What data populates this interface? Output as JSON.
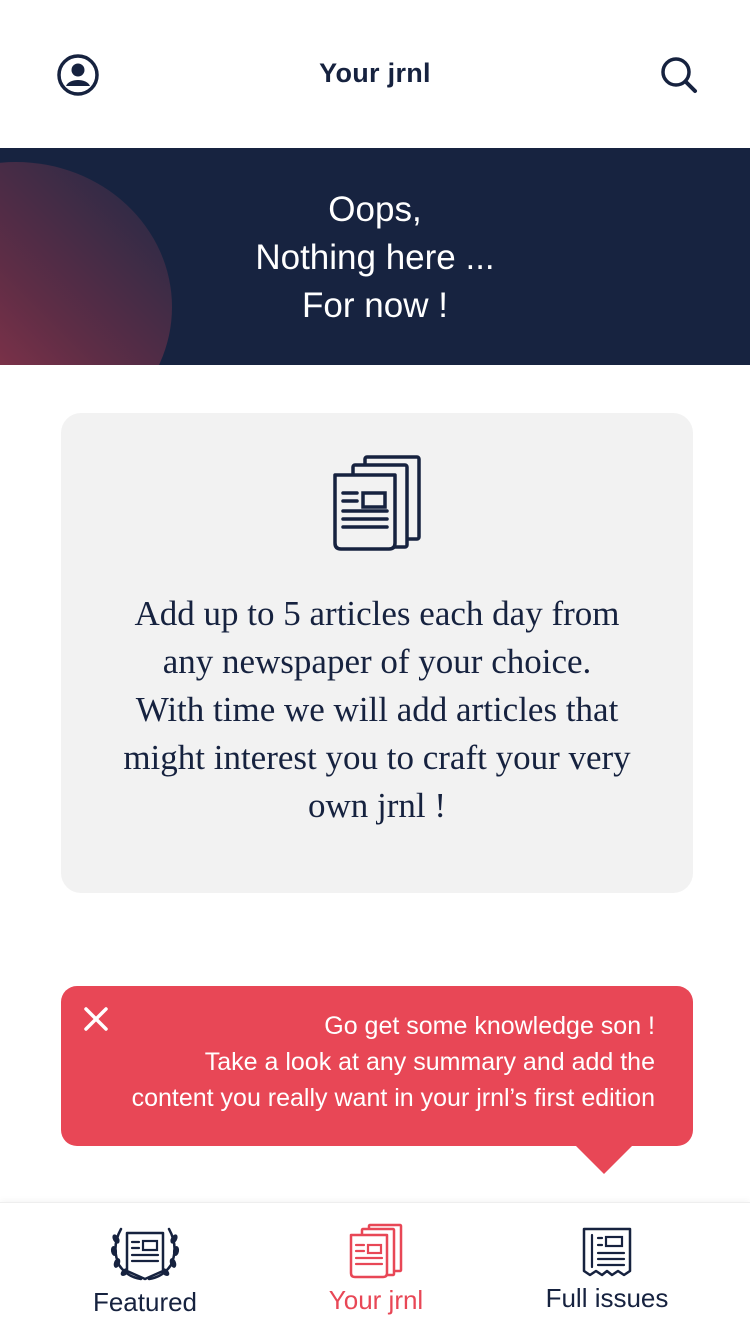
{
  "header": {
    "title": "Your jrnl",
    "left_icon": "profile-icon",
    "right_icon": "search-icon"
  },
  "banner": {
    "lines": [
      "Oops,",
      "Nothing here ...",
      "For now !"
    ]
  },
  "info": {
    "icon": "newspaper-stack-icon",
    "lines": [
      "Add up to 5 articles each day from",
      "any newspaper of your choice.",
      "With time we will add articles that",
      "might interest you to craft your very",
      "own jrnl !"
    ]
  },
  "toast": {
    "close_icon": "close-icon",
    "lines": [
      "Go get some knowledge son !",
      "Take a look at any summary and add the",
      "content you really want in your jrnl’s first edition"
    ]
  },
  "tabs": [
    {
      "label": "Featured",
      "icon": "laurel-newspaper-icon",
      "active": false
    },
    {
      "label": "Your jrnl",
      "icon": "newspaper-stack-icon",
      "active": true
    },
    {
      "label": "Full issues",
      "icon": "newspaper-icon",
      "active": false
    }
  ],
  "colors": {
    "navy": "#172340",
    "text": "#16223f",
    "accent": "#e84756",
    "card": "#f2f2f2"
  }
}
